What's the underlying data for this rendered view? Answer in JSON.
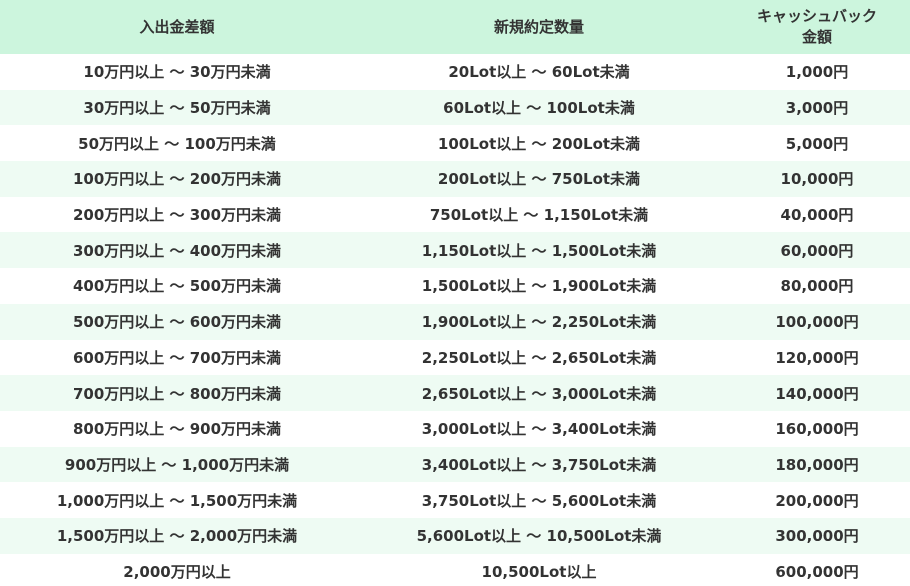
{
  "headers": {
    "deposit_diff": "入出金差額",
    "new_volume": "新規約定数量",
    "cashback_line1": "キャッシュバック",
    "cashback_line2": "金額"
  },
  "rows": [
    {
      "deposit": "10万円以上 ～ 30万円未満",
      "lots": "20Lot以上 ～ 60Lot未満",
      "cashback": "1,000円"
    },
    {
      "deposit": "30万円以上 ～ 50万円未満",
      "lots": "60Lot以上 ～ 100Lot未満",
      "cashback": "3,000円"
    },
    {
      "deposit": "50万円以上 ～ 100万円未満",
      "lots": "100Lot以上 ～ 200Lot未満",
      "cashback": "5,000円"
    },
    {
      "deposit": "100万円以上 ～ 200万円未満",
      "lots": "200Lot以上 ～ 750Lot未満",
      "cashback": "10,000円"
    },
    {
      "deposit": "200万円以上 ～ 300万円未満",
      "lots": "750Lot以上 ～ 1,150Lot未満",
      "cashback": "40,000円"
    },
    {
      "deposit": "300万円以上 ～ 400万円未満",
      "lots": "1,150Lot以上 ～ 1,500Lot未満",
      "cashback": "60,000円"
    },
    {
      "deposit": "400万円以上 ～ 500万円未満",
      "lots": "1,500Lot以上 ～ 1,900Lot未満",
      "cashback": "80,000円"
    },
    {
      "deposit": "500万円以上 ～ 600万円未満",
      "lots": "1,900Lot以上 ～ 2,250Lot未満",
      "cashback": "100,000円"
    },
    {
      "deposit": "600万円以上 ～ 700万円未満",
      "lots": "2,250Lot以上 ～ 2,650Lot未満",
      "cashback": "120,000円"
    },
    {
      "deposit": "700万円以上 ～ 800万円未満",
      "lots": "2,650Lot以上 ～ 3,000Lot未満",
      "cashback": "140,000円"
    },
    {
      "deposit": "800万円以上 ～ 900万円未満",
      "lots": "3,000Lot以上 ～ 3,400Lot未満",
      "cashback": "160,000円"
    },
    {
      "deposit": "900万円以上 ～ 1,000万円未満",
      "lots": "3,400Lot以上 ～ 3,750Lot未満",
      "cashback": "180,000円"
    },
    {
      "deposit": "1,000万円以上 ～ 1,500万円未満",
      "lots": "3,750Lot以上 ～ 5,600Lot未満",
      "cashback": "200,000円"
    },
    {
      "deposit": "1,500万円以上 ～ 2,000万円未満",
      "lots": "5,600Lot以上 ～ 10,500Lot未満",
      "cashback": "300,000円"
    },
    {
      "deposit": "2,000万円以上",
      "lots": "10,500Lot以上",
      "cashback": "600,000円"
    }
  ],
  "colors": {
    "header_bg": "#ccf5dd",
    "alt_row_bg": "#eefbf3",
    "text": "#333333"
  }
}
